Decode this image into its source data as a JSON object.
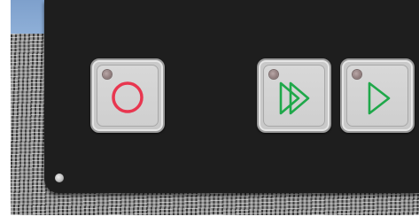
{
  "control_panel": {
    "buttons": [
      {
        "id": "record",
        "icon": "record-circle-icon",
        "icon_color": "#e8364f",
        "led_state": "off"
      },
      {
        "id": "fast-forward",
        "icon": "fast-forward-icon",
        "icon_color": "#1fa84a",
        "led_state": "off"
      },
      {
        "id": "play",
        "icon": "play-icon",
        "icon_color": "#1fa84a",
        "led_state": "off"
      }
    ]
  },
  "colors": {
    "panel": "#1e1e1e",
    "button_face": "#cfcfcf",
    "record_accent": "#e8364f",
    "play_accent": "#1fa84a",
    "led_off": "#8a7777"
  }
}
